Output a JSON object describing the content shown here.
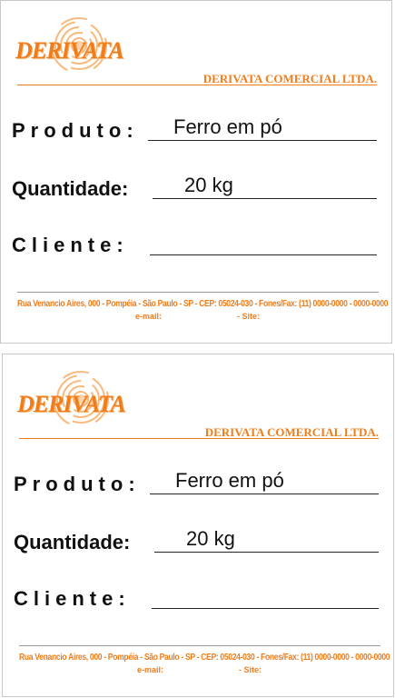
{
  "labels": [
    {
      "logo_text": "DERIVATA",
      "company": "DERIVATA COMERCIAL LTDA.",
      "fields": {
        "produto": {
          "label": "Produto",
          "colon": ":",
          "value": "Ferro em pó"
        },
        "quantidade": {
          "label": "Quantidade",
          "colon": ":",
          "value": "20 kg"
        },
        "cliente": {
          "label": "Cliente",
          "colon": ":",
          "value": ""
        }
      },
      "address": "Rua Venancio Aires, 000 - Pompéia - São Paulo - SP - CEP: 05024-030 - Fones/Fax: (11) 0000-0000 - 0000-0000",
      "email_label": "e-mail:",
      "site_label": "- Site:"
    },
    {
      "logo_text": "DERIVATA",
      "company": "DERIVATA COMERCIAL LTDA.",
      "fields": {
        "produto": {
          "label": "Produto",
          "colon": ":",
          "value": "Ferro em pó"
        },
        "quantidade": {
          "label": "Quantidade",
          "colon": ":",
          "value": "20 kg"
        },
        "cliente": {
          "label": "Cliente",
          "colon": ":",
          "value": ""
        }
      },
      "address": "Rua Venancio Aires, 000 - Pompéia - São Paulo - SP - CEP: 05024-030 - Fones/Fax: (11) 0000-0000 - 0000-0000",
      "email_label": "e-mail:",
      "site_label": "- Site:"
    }
  ],
  "colors": {
    "brand_orange": "#f07d1a",
    "text": "#111111"
  },
  "icons": {
    "logo": "orange-swirl-logo-icon"
  }
}
